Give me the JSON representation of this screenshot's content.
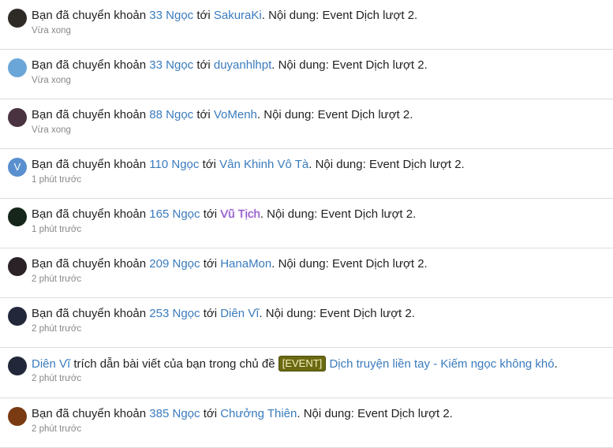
{
  "notifications": [
    {
      "avatar_color": "#2e2a26",
      "prefix": "Bạn đã chuyển khoản",
      "amount": "33 Ngọc",
      "to": "tới",
      "user": "SakuraKi",
      "suffix": ". Nội dung: Event Dịch lượt 2.",
      "time": "Vừa xong"
    },
    {
      "avatar_color": "#6aa6d8",
      "prefix": "Bạn đã chuyển khoản",
      "amount": "33 Ngọc",
      "to": "tới",
      "user": "duyanhlhpt",
      "suffix": ". Nội dung: Event Dịch lượt 2.",
      "time": "Vừa xong"
    },
    {
      "avatar_color": "#4a3340",
      "prefix": "Bạn đã chuyển khoản",
      "amount": "88 Ngọc",
      "to": "tới",
      "user": "VoMenh",
      "suffix": ". Nội dung: Event Dịch lượt 2.",
      "time": "Vừa xong"
    },
    {
      "avatar_color": "#5a8fcf",
      "avatar_letter": "V",
      "prefix": "Bạn đã chuyển khoản",
      "amount": "110 Ngọc",
      "to": "tới",
      "user": "Vân Khinh Vô Tà",
      "suffix": ". Nội dung: Event Dịch lượt 2.",
      "time": "1 phút trước"
    },
    {
      "avatar_color": "#16261a",
      "prefix": "Bạn đã chuyển khoản",
      "amount": "165 Ngọc",
      "to": "tới",
      "user": "Vũ Tịch",
      "suffix": ". Nội dung: Event Dịch lượt 2.",
      "time": "1 phút trước",
      "user_style": "purple"
    },
    {
      "avatar_color": "#2a2226",
      "prefix": "Bạn đã chuyển khoản",
      "amount": "209 Ngọc",
      "to": "tới",
      "user": "HanaMon",
      "suffix": ". Nội dung: Event Dịch lượt 2.",
      "time": "2 phút trước"
    },
    {
      "avatar_color": "#22283a",
      "prefix": "Bạn đã chuyển khoản",
      "amount": "253 Ngọc",
      "to": "tới",
      "user": "Diên Vĩ",
      "suffix": ". Nội dung: Event Dịch lượt 2.",
      "time": "2 phút trước"
    }
  ],
  "quote_notification": {
    "avatar_color": "#22283a",
    "user": "Diên Vĩ",
    "text": "trích dẫn bài viết của bạn trong chủ đề",
    "tag": "[EVENT]",
    "thread": "Dịch truyện liền tay - Kiếm ngọc không khó",
    "end": ".",
    "time": "2 phút trước"
  },
  "last_notification": {
    "avatar_color": "#7a3a12",
    "prefix": "Bạn đã chuyển khoản",
    "amount": "385 Ngọc",
    "to": "tới",
    "user": "Chưởng Thiên",
    "suffix": ". Nội dung: Event Dịch lượt 2.",
    "time": "2 phút trước"
  }
}
